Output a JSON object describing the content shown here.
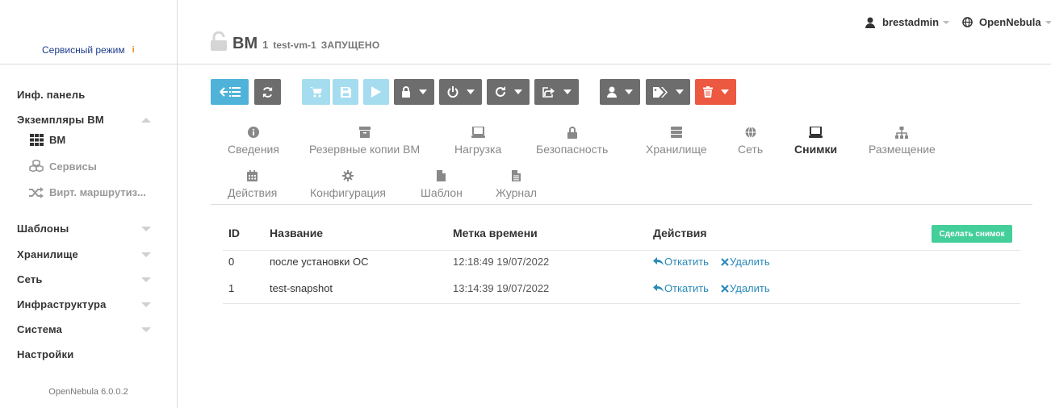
{
  "sidebar": {
    "service_mode": "Сервисный режим",
    "service_mode_info": "i",
    "items": [
      {
        "label": "Инф. панель"
      },
      {
        "label": "Экземпляры ВМ"
      },
      {
        "label": "Шаблоны"
      },
      {
        "label": "Хранилище"
      },
      {
        "label": "Сеть"
      },
      {
        "label": "Инфраструктура"
      },
      {
        "label": "Система"
      },
      {
        "label": "Настройки"
      }
    ],
    "subitems": [
      {
        "label": "ВМ",
        "icon": "grid-icon",
        "active": true
      },
      {
        "label": "Сервисы",
        "icon": "cubes-icon"
      },
      {
        "label": "Вирт. маршрутиз...",
        "icon": "random-icon"
      }
    ],
    "version": "OpenNebula 6.0.0.2"
  },
  "header": {
    "title": "ВМ",
    "vm_id": "1",
    "vm_name": "test-vm-1",
    "vm_state": "ЗАПУЩЕНО",
    "user": "brestadmin",
    "zone": "OpenNebula"
  },
  "tabs": [
    {
      "label": "Сведения",
      "icon": "info-icon"
    },
    {
      "label": "Резервные копии ВМ",
      "icon": "archive-icon"
    },
    {
      "label": "Нагрузка",
      "icon": "laptop-icon"
    },
    {
      "label": "Безопасность",
      "icon": "lock-icon"
    },
    {
      "label": "Хранилище",
      "icon": "storage-icon"
    },
    {
      "label": "Сеть",
      "icon": "globe-icon"
    },
    {
      "label": "Снимки",
      "icon": "laptop-icon",
      "active": true
    },
    {
      "label": "Размещение",
      "icon": "sitemap-icon"
    },
    {
      "label": "Действия",
      "icon": "calendar-icon"
    },
    {
      "label": "Конфигурация",
      "icon": "cog-icon"
    },
    {
      "label": "Шаблон",
      "icon": "file-icon"
    },
    {
      "label": "Журнал",
      "icon": "file-text-icon"
    }
  ],
  "snapshots": {
    "columns": {
      "id": "ID",
      "name": "Название",
      "timestamp": "Метка времени",
      "actions": "Действия"
    },
    "take_snapshot": "Сделать снимок",
    "rows": [
      {
        "id": "0",
        "name": "после установки ОС",
        "timestamp": "12:18:49 19/07/2022",
        "revert": "Откатить",
        "delete": "Удалить"
      },
      {
        "id": "1",
        "name": "test-snapshot",
        "timestamp": "13:14:39 19/07/2022",
        "revert": "Откатить",
        "delete": "Удалить"
      }
    ]
  },
  "colors": {
    "primary": "#4fb3d9",
    "gray_button": "#6d6d6d",
    "danger": "#ec5840",
    "success": "#43ce9a",
    "link": "#2a8ab8"
  }
}
